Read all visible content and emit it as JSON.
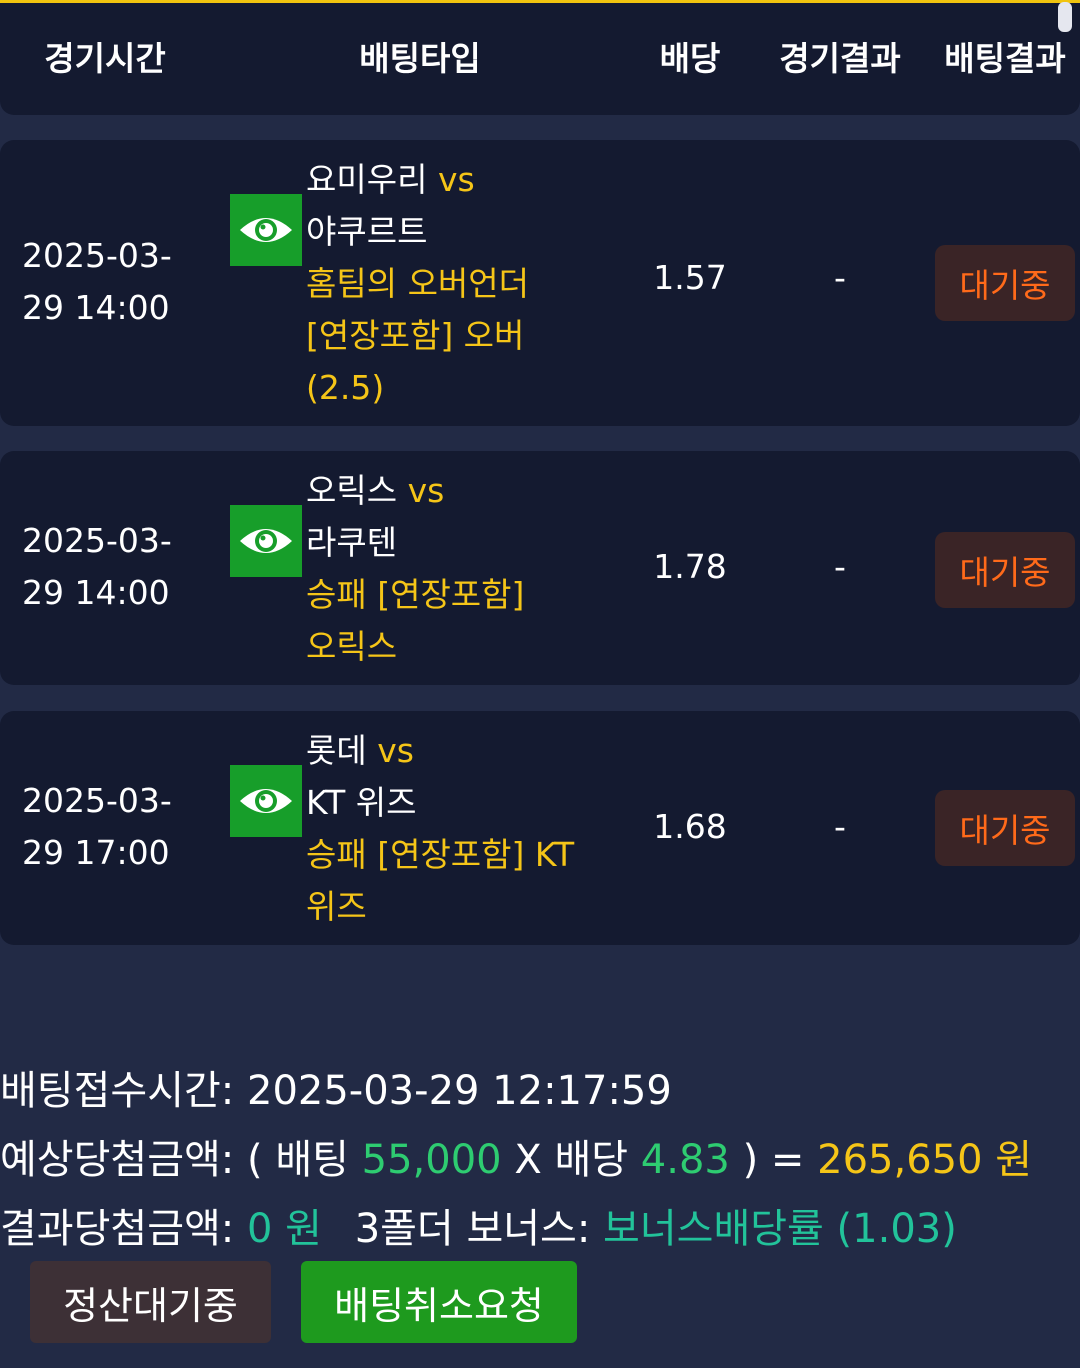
{
  "header": {
    "time": "경기시간",
    "bet_type": "배팅타입",
    "odds": "배당",
    "game_result": "경기결과",
    "bet_result": "배팅결과"
  },
  "bets": [
    {
      "time": "2025-03-29 14:00",
      "home": "요미우리",
      "vs": "vs",
      "away": "야쿠르트",
      "pick": "홈팀의 오버언더 [연장포함] 오버 (2.5)",
      "odds": "1.57",
      "result": "-",
      "status": "대기중"
    },
    {
      "time": "2025-03-29 14:00",
      "home": "오릭스",
      "vs": "vs",
      "away": "라쿠텐",
      "pick": "승패 [연장포함] 오릭스",
      "odds": "1.78",
      "result": "-",
      "status": "대기중"
    },
    {
      "time": "2025-03-29 17:00",
      "home": "롯데",
      "vs": "vs",
      "away": "KT 위즈",
      "pick": "승패 [연장포함] KT 위즈",
      "odds": "1.68",
      "result": "-",
      "status": "대기중"
    }
  ],
  "summary": {
    "receipt_label": "배팅접수시간:",
    "receipt_time": "2025-03-29 12:17:59",
    "expected_label": "예상당첨금액:",
    "open_paren": "(",
    "bet_word": "배팅",
    "bet_amount": "55,000",
    "times": "X",
    "odds_word": "배당",
    "total_odds": "4.83",
    "close_paren": ")",
    "equals": "=",
    "expected_amount": "265,650 원",
    "actual_label": "결과당첨금액:",
    "actual_amount": "0 원",
    "bonus_label": "3폴더 보너스:",
    "bonus_value": "보너스배당률 (1.03)"
  },
  "buttons": {
    "settle_wait": "정산대기중",
    "cancel_request": "배팅취소요청"
  },
  "colors": {
    "background": "#222a45",
    "card": "#141a30",
    "accent_yellow": "#f5c518",
    "status_orange": "#ff6a1a",
    "green": "#2ecc71",
    "eye_button": "#179e2a"
  },
  "icons": {
    "detail": "eye-icon"
  }
}
